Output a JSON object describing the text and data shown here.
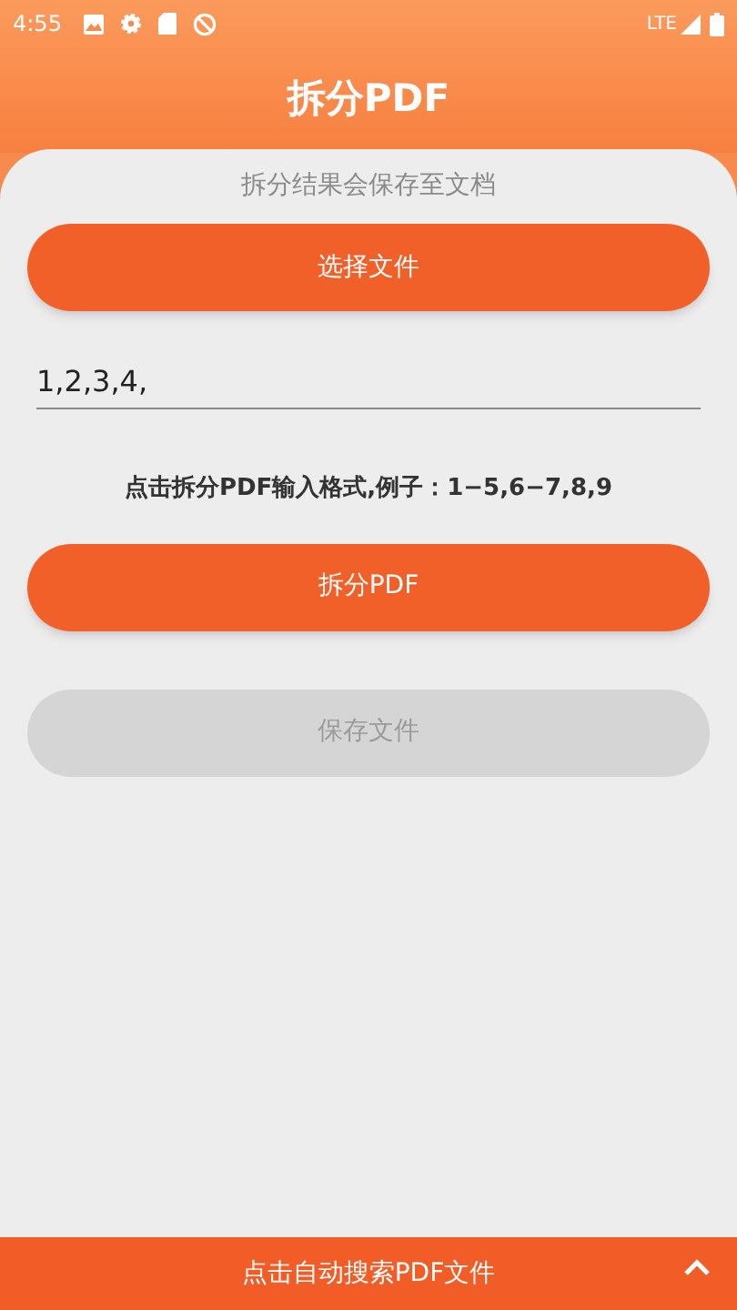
{
  "status_bar": {
    "time": "4:55",
    "network": "LTE"
  },
  "header": {
    "title": "拆分PDF"
  },
  "notice": "拆分结果会保存至文档",
  "select_button": {
    "label": "选择文件",
    "disabled": false
  },
  "page_input": {
    "value": "1,2,3,4,"
  },
  "hint": "点击拆分PDF输入格式,例子：1−5,6−7,8,9",
  "split_button": {
    "label": "拆分PDF",
    "disabled": false
  },
  "save_button": {
    "label": "保存文件",
    "disabled": true
  },
  "bottom_bar": {
    "label": "点击自动搜索PDF文件"
  }
}
